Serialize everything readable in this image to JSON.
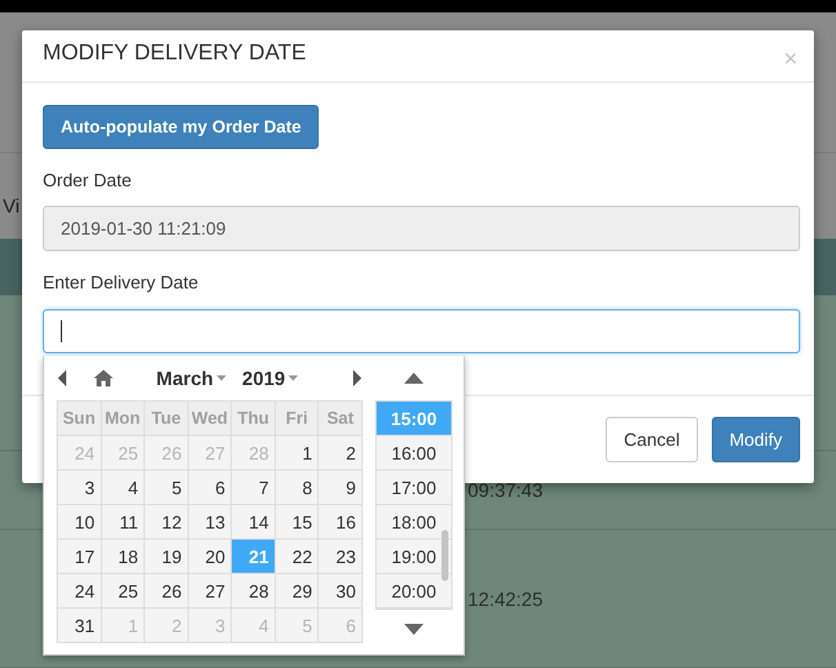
{
  "background": {
    "column_1_text": "Vi",
    "times": [
      "09:37:43",
      "12:42:25"
    ]
  },
  "dialog": {
    "title": "MODIFY DELIVERY DATE",
    "close": "×",
    "autofill_button": "Auto-populate my Order Date",
    "order_date": {
      "label": "Order Date",
      "value": "2019-01-30 11:21:09",
      "disabled": true
    },
    "delivery_date": {
      "label": "Enter Delivery Date",
      "focused": true
    },
    "buttons": [
      {
        "label": "Cancel",
        "kind": "default"
      },
      {
        "label": "Modify",
        "kind": "primary"
      }
    ]
  },
  "datepicker": {
    "month": "March",
    "year": "2019",
    "weekdays": [
      "Sun",
      "Mon",
      "Tue",
      "Wed",
      "Thu",
      "Fri",
      "Sat"
    ],
    "weeks": [
      [
        {
          "day": "24",
          "other_month": true,
          "selected": false
        },
        {
          "day": "25",
          "other_month": true,
          "selected": false
        },
        {
          "day": "26",
          "other_month": true,
          "selected": false
        },
        {
          "day": "27",
          "other_month": true,
          "selected": false
        },
        {
          "day": "28",
          "other_month": true,
          "selected": false
        },
        {
          "day": "1",
          "other_month": false,
          "selected": false
        },
        {
          "day": "2",
          "other_month": false,
          "selected": false
        }
      ],
      [
        {
          "day": "3",
          "other_month": false,
          "selected": false
        },
        {
          "day": "4",
          "other_month": false,
          "selected": false
        },
        {
          "day": "5",
          "other_month": false,
          "selected": false
        },
        {
          "day": "6",
          "other_month": false,
          "selected": false
        },
        {
          "day": "7",
          "other_month": false,
          "selected": false
        },
        {
          "day": "8",
          "other_month": false,
          "selected": false
        },
        {
          "day": "9",
          "other_month": false,
          "selected": false
        }
      ],
      [
        {
          "day": "10",
          "other_month": false,
          "selected": false
        },
        {
          "day": "11",
          "other_month": false,
          "selected": false
        },
        {
          "day": "12",
          "other_month": false,
          "selected": false
        },
        {
          "day": "13",
          "other_month": false,
          "selected": false
        },
        {
          "day": "14",
          "other_month": false,
          "selected": false
        },
        {
          "day": "15",
          "other_month": false,
          "selected": false
        },
        {
          "day": "16",
          "other_month": false,
          "selected": false
        }
      ],
      [
        {
          "day": "17",
          "other_month": false,
          "selected": false
        },
        {
          "day": "18",
          "other_month": false,
          "selected": false
        },
        {
          "day": "19",
          "other_month": false,
          "selected": false
        },
        {
          "day": "20",
          "other_month": false,
          "selected": false
        },
        {
          "day": "21",
          "other_month": false,
          "selected": true
        },
        {
          "day": "22",
          "other_month": false,
          "selected": false
        },
        {
          "day": "23",
          "other_month": false,
          "selected": false
        }
      ],
      [
        {
          "day": "24",
          "other_month": false,
          "selected": false
        },
        {
          "day": "25",
          "other_month": false,
          "selected": false
        },
        {
          "day": "26",
          "other_month": false,
          "selected": false
        },
        {
          "day": "27",
          "other_month": false,
          "selected": false
        },
        {
          "day": "28",
          "other_month": false,
          "selected": false
        },
        {
          "day": "29",
          "other_month": false,
          "selected": false
        },
        {
          "day": "30",
          "other_month": false,
          "selected": false
        }
      ],
      [
        {
          "day": "31",
          "other_month": false,
          "selected": false
        },
        {
          "day": "1",
          "other_month": true,
          "selected": false
        },
        {
          "day": "2",
          "other_month": true,
          "selected": false
        },
        {
          "day": "3",
          "other_month": true,
          "selected": false
        },
        {
          "day": "4",
          "other_month": true,
          "selected": false
        },
        {
          "day": "5",
          "other_month": true,
          "selected": false
        },
        {
          "day": "6",
          "other_month": true,
          "selected": false
        }
      ]
    ],
    "times": [
      {
        "label": "15:00",
        "selected": true
      },
      {
        "label": "16:00",
        "selected": false
      },
      {
        "label": "17:00",
        "selected": false
      },
      {
        "label": "18:00",
        "selected": false
      },
      {
        "label": "19:00",
        "selected": false
      },
      {
        "label": "20:00",
        "selected": false
      }
    ]
  }
}
